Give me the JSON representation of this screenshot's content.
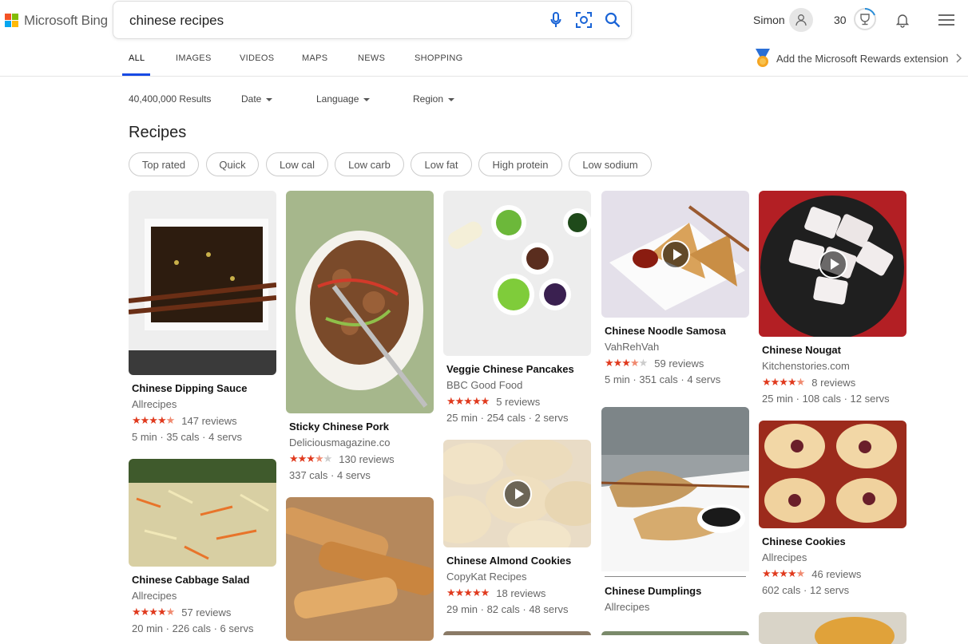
{
  "header": {
    "logo_text": "Microsoft Bing",
    "search_query": "chinese recipes",
    "user_name": "Simon",
    "points": "30"
  },
  "tabs": [
    {
      "label": "ALL"
    },
    {
      "label": "IMAGES"
    },
    {
      "label": "VIDEOS"
    },
    {
      "label": "MAPS"
    },
    {
      "label": "NEWS"
    },
    {
      "label": "SHOPPING"
    }
  ],
  "extension_prompt": "Add the Microsoft Rewards extension",
  "filters": {
    "results_count": "40,400,000 Results",
    "date": "Date",
    "language": "Language",
    "region": "Region"
  },
  "section_title": "Recipes",
  "chips": [
    "Top rated",
    "Quick",
    "Low cal",
    "Low carb",
    "Low fat",
    "High protein",
    "Low sodium"
  ],
  "recipes": [
    {
      "title": "Chinese Dipping Sauce",
      "source": "Allrecipes",
      "rating": 4.5,
      "reviews": "147 reviews",
      "meta": "5 min · 35 cals · 4 servs"
    },
    {
      "title": "Chinese Cabbage Salad",
      "source": "Allrecipes",
      "rating": 4.5,
      "reviews": "57 reviews",
      "meta": "20 min · 226 cals · 6 servs"
    },
    {
      "title": "Sticky Chinese Pork",
      "source": "Deliciousmagazine.co",
      "rating": 3.5,
      "reviews": "130 reviews",
      "meta": "337 cals · 4 servs"
    },
    {
      "title": "Veggie Chinese Pancakes",
      "source": "BBC Good Food",
      "rating": 5,
      "reviews": "5 reviews",
      "meta": "25 min · 254 cals · 2 servs"
    },
    {
      "title": "Chinese Almond Cookies",
      "source": "CopyKat Recipes",
      "rating": 5,
      "reviews": "18 reviews",
      "meta": "29 min · 82 cals · 48 servs"
    },
    {
      "title": "Chinese Noodle Samosa",
      "source": "VahRehVah",
      "rating": 3.5,
      "reviews": "59 reviews",
      "meta": "5 min · 351 cals · 4 servs"
    },
    {
      "title": "Chinese Dumplings",
      "source": "Allrecipes"
    },
    {
      "title": "Chinese Nougat",
      "source": "Kitchenstories.com",
      "rating": 4.5,
      "reviews": "8 reviews",
      "meta": "25 min · 108 cals · 12 servs"
    },
    {
      "title": "Chinese Cookies",
      "source": "Allrecipes",
      "rating": 4.5,
      "reviews": "46 reviews",
      "meta": "602 cals · 12 servs"
    }
  ],
  "colors": {
    "accent": "#174ae4",
    "star": "#e03a1e"
  }
}
